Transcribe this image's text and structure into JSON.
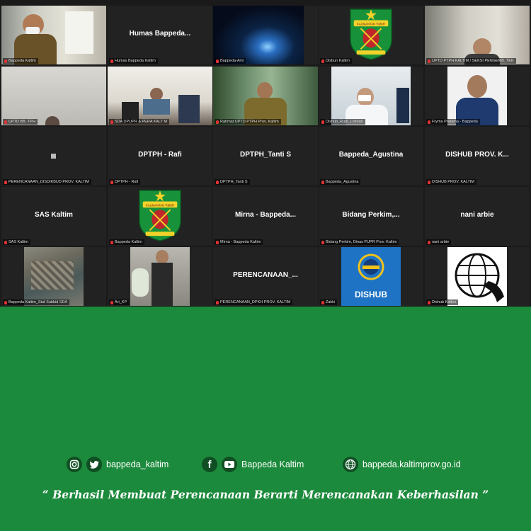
{
  "tiles": [
    {
      "label": "Bappeda Kaltim",
      "center": ""
    },
    {
      "label": "Humas Bappeda Kaltim",
      "center": "Humas  Bappeda..."
    },
    {
      "label": "Bappeda-Aini",
      "center": ""
    },
    {
      "label": "Disbun Kaltim",
      "center": ""
    },
    {
      "label": "UPTD PTPH KALTIM / SEKSI PENGEMB. TEK",
      "center": ""
    },
    {
      "label": "UPTD BB. TPH",
      "center": ""
    },
    {
      "label": "SDA DPUPR & PERA KALT M",
      "center": ""
    },
    {
      "label": "Rahmat UPTD PTPH Prov. Kaltim",
      "center": ""
    },
    {
      "label": "Dishub_Rudi_Lotnian",
      "center": ""
    },
    {
      "label": "Fryma Pratama - Bappeda",
      "center": ""
    },
    {
      "label": "PERENCANAAN_DISDIKBUD PROV. KALTIM",
      "center": ""
    },
    {
      "label": "DPTPH - Rafi",
      "center": "DPTPH - Rafi"
    },
    {
      "label": "DPTPH_Tanti S",
      "center": "DPTPH_Tanti S"
    },
    {
      "label": "Bappeda_Agustina",
      "center": "Bappeda_Agustina"
    },
    {
      "label": "DISHUB PROV. KALTIM",
      "center": "DISHUB PROV. K..."
    },
    {
      "label": "SAS Kaltim",
      "center": "SAS Kaltim"
    },
    {
      "label": "Bappeda Kaltim",
      "center": ""
    },
    {
      "label": "Mirna - Bappeda Kaltim",
      "center": "Mirna - Bappeda..."
    },
    {
      "label": "Bidang Perkim, Dinas PUPR Prov. Kaltim",
      "center": "Bidang  Perkim,..."
    },
    {
      "label": "nani arbie",
      "center": "nani arbie"
    },
    {
      "label": "Bappeda Kaltim_Staf Subbid SDA",
      "center": ""
    },
    {
      "label": "Ari_KP",
      "center": ""
    },
    {
      "label": "PERENCANAAN_DPKH PROV. KALTIM",
      "center": "PERENCANAAN_..."
    },
    {
      "label": "Zakki",
      "center": ""
    },
    {
      "label": "Dishub Kaltim",
      "center": ""
    }
  ],
  "logo_texts": {
    "kaltim_banner": "KALIMANTAN TIMUR",
    "dishub": "DISHUB"
  },
  "footer": {
    "social_instagram": "bappeda_kaltim",
    "social_youtube": "Bappeda Kaltim",
    "website": "bappeda.kaltimprov.go.id",
    "quote": "“ Berhasil  Membuat Perencanaan Berarti Merencanakan Keberhasilan ”"
  },
  "colors": {
    "background_green": "#1c8a3c",
    "active_speaker": "#c8d94a",
    "muted_mic": "#dd3333"
  }
}
